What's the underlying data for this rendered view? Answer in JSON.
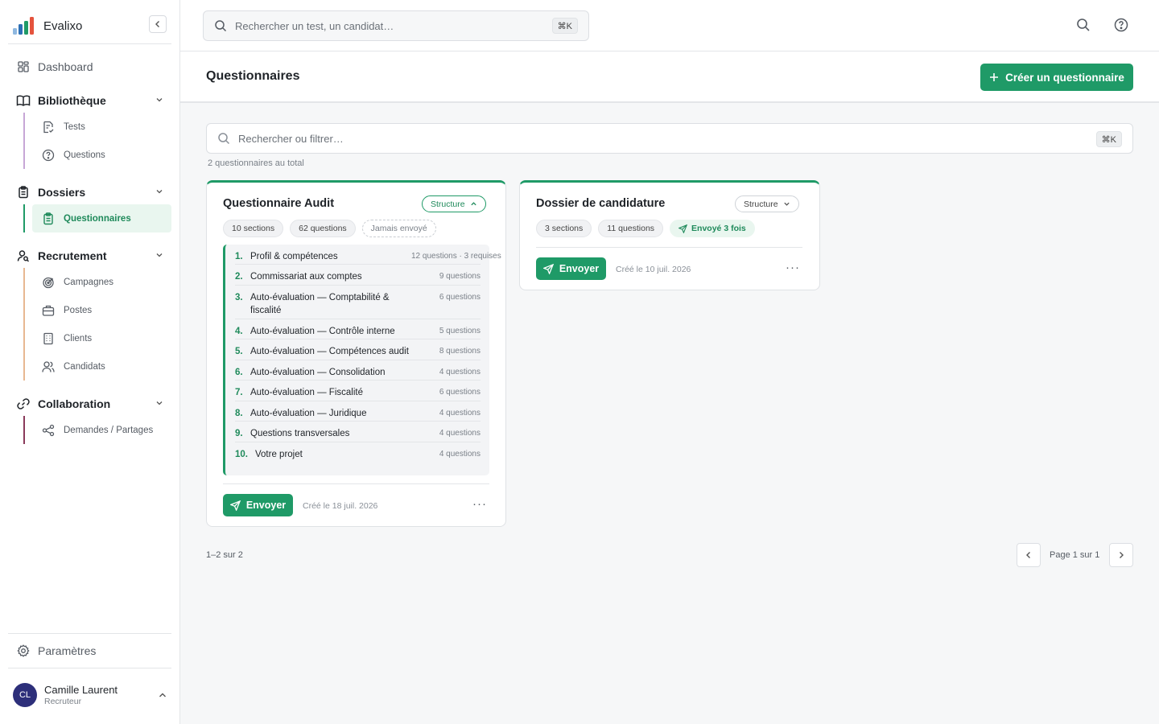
{
  "app": {
    "name": "Evalixo"
  },
  "sidebar": {
    "dashboard": "Dashboard",
    "groups": [
      {
        "label": "Bibliothèque",
        "accent": "#c7a7d6",
        "items": [
          "Tests",
          "Questions"
        ]
      },
      {
        "label": "Dossiers",
        "accent": "#1f9a67",
        "items": [
          "Questionnaires"
        ]
      },
      {
        "label": "Recrutement",
        "accent": "#e8b891",
        "items": [
          "Campagnes",
          "Postes",
          "Clients",
          "Candidats"
        ]
      },
      {
        "label": "Collaboration",
        "accent": "#8a3a5a",
        "items": [
          "Demandes / Partages"
        ]
      }
    ],
    "settings": "Paramètres",
    "user": {
      "initials": "CL",
      "name": "Camille Laurent",
      "role": "Recruteur"
    }
  },
  "topbar": {
    "search_placeholder": "Rechercher un test, un candidat…",
    "shortcut": "⌘K"
  },
  "page": {
    "title": "Questionnaires",
    "create_label": "Créer un questionnaire",
    "filter_placeholder": "Rechercher ou filtrer…",
    "filter_shortcut": "⌘K",
    "total": "2 questionnaires au total"
  },
  "cards": [
    {
      "title": "Questionnaire Audit",
      "structure_label": "Structure",
      "chips": [
        "10 sections",
        "62 questions",
        "Jamais envoyé"
      ],
      "sections": [
        {
          "num": "1.",
          "name": "Profil & compétences",
          "meta": "12 questions · 3 requises"
        },
        {
          "num": "2.",
          "name": "Commissariat aux comptes",
          "meta": "9 questions"
        },
        {
          "num": "3.",
          "name": "Auto-évaluation — Comptabilité & fiscalité",
          "meta": "6 questions"
        },
        {
          "num": "4.",
          "name": "Auto-évaluation — Contrôle interne",
          "meta": "5 questions"
        },
        {
          "num": "5.",
          "name": "Auto-évaluation — Compétences audit",
          "meta": "8 questions"
        },
        {
          "num": "6.",
          "name": "Auto-évaluation — Consolidation",
          "meta": "4 questions"
        },
        {
          "num": "7.",
          "name": "Auto-évaluation — Fiscalité",
          "meta": "6 questions"
        },
        {
          "num": "8.",
          "name": "Auto-évaluation — Juridique",
          "meta": "4 questions"
        },
        {
          "num": "9.",
          "name": "Questions transversales",
          "meta": "4 questions"
        },
        {
          "num": "10.",
          "name": "Votre projet",
          "meta": "4 questions"
        }
      ],
      "send_label": "Envoyer",
      "created": "Créé le 18 juil. 2026",
      "more": "···"
    },
    {
      "title": "Dossier de candidature",
      "structure_label": "Structure",
      "chips": [
        "3 sections",
        "11 questions",
        "Envoyé 3 fois"
      ],
      "send_label": "Envoyer",
      "created": "Créé le 10 juil. 2026",
      "more": "···"
    }
  ],
  "pagination": {
    "count": "1–2 sur 2",
    "label": "Page 1 sur 1"
  },
  "colors": {
    "brand": "#1f9a67",
    "brand_soft": "#e9f6ef",
    "avatar": "#2d2f7a"
  }
}
